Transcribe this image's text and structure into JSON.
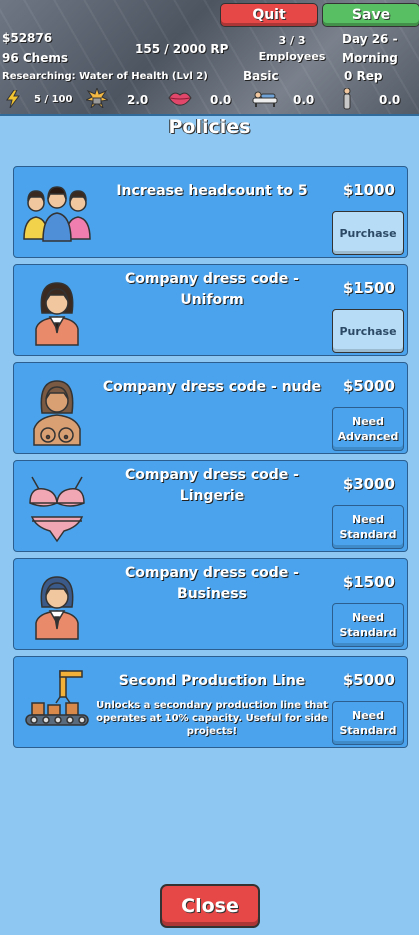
{
  "top_buttons": {
    "quit": "Quit",
    "save": "Save"
  },
  "stats": {
    "money": "$52876",
    "chems": "96 Chems",
    "rp": "155 / 2000 RP",
    "employees_count": "3 / 3",
    "employees_label": "Employees",
    "day": "Day 26 -",
    "time": "Morning",
    "researching": "Researching: Water of Health (Lvl 2)",
    "tier": "Basic",
    "rep": "0 Rep",
    "energy": "5 / 100",
    "stat2": "2.0",
    "stat3": "0.0",
    "stat4": "0.0",
    "stat5": "0.0"
  },
  "panel": {
    "title": "Policies",
    "close": "Close"
  },
  "policies": [
    {
      "name": "Increase headcount to 5",
      "price": "$1000",
      "button": "Purchase",
      "icon": "people-group-icon"
    },
    {
      "name": "Company dress code - Uniform",
      "price": "$1500",
      "button": "Purchase",
      "icon": "woman-uniform-icon"
    },
    {
      "name": "Company dress code - nude",
      "price": "$5000",
      "button": "Need Advanced",
      "icon": "woman-nude-icon"
    },
    {
      "name": "Company dress code - Lingerie",
      "price": "$3000",
      "button": "Need Standard",
      "icon": "lingerie-icon"
    },
    {
      "name": "Company dress code - Business",
      "price": "$1500",
      "button": "Need Standard",
      "icon": "woman-business-icon"
    },
    {
      "name": "Second Production Line",
      "price": "$5000",
      "button": "Need Standard",
      "icon": "conveyor-icon",
      "description": "Unlocks a secondary production line that operates at 10% capacity. Useful for side projects!"
    }
  ],
  "colors": {
    "panel": "#8ec8f2",
    "card": "#4aa3ec",
    "red_button": "#e64747",
    "green_button": "#58c063"
  }
}
